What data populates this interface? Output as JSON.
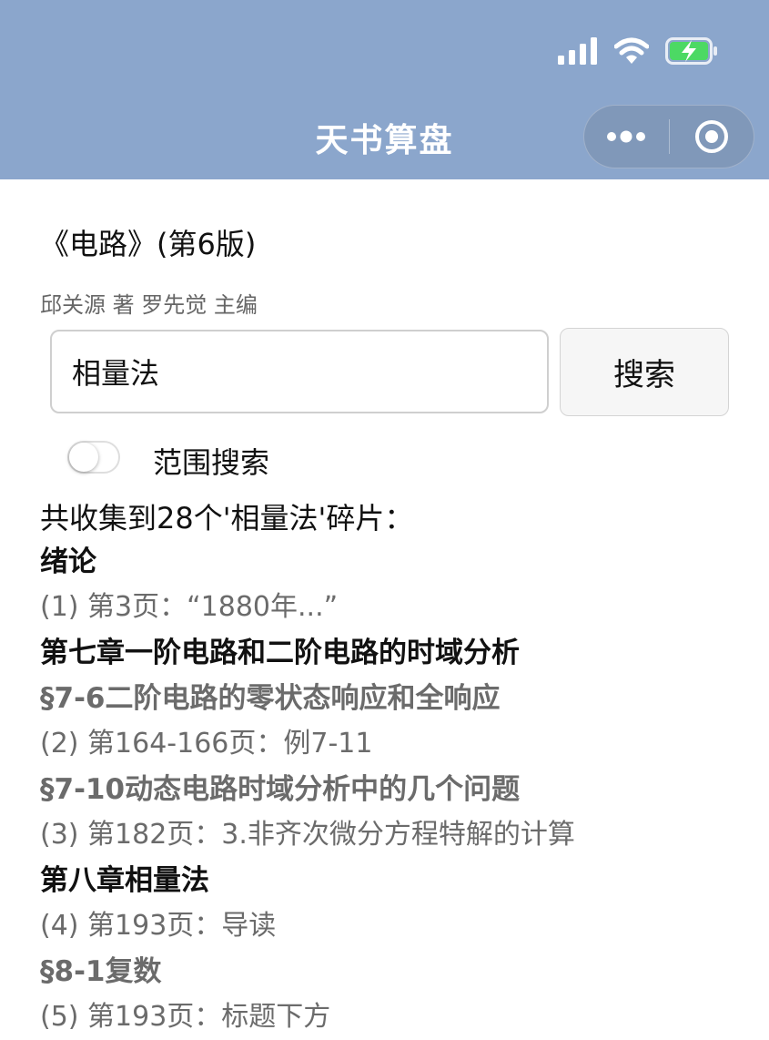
{
  "nav": {
    "title": "天书算盘"
  },
  "book": {
    "title": "《电路》(第6版)",
    "authors": "邱关源 著 罗先觉 主编"
  },
  "search": {
    "value": "相量法",
    "button_label": "搜索"
  },
  "range_toggle": {
    "label": "范围搜索",
    "on": false
  },
  "summary": "共收集到28个'相量法'碎片：",
  "results": [
    {
      "type": "chapter",
      "text": "绪论"
    },
    {
      "type": "entry",
      "text": "(1) 第3页：“1880年...”"
    },
    {
      "type": "chapter",
      "text": "第七章一阶电路和二阶电路的时域分析"
    },
    {
      "type": "section",
      "text": "§7-6二阶电路的零状态响应和全响应"
    },
    {
      "type": "entry",
      "text": "(2) 第164-166页：例7-11"
    },
    {
      "type": "section",
      "text": "§7-10动态电路时域分析中的几个问题"
    },
    {
      "type": "entry",
      "text": "(3) 第182页：3.非齐次微分方程特解的计算"
    },
    {
      "type": "chapter",
      "text": "第八章相量法"
    },
    {
      "type": "entry",
      "text": "(4) 第193页：导读"
    },
    {
      "type": "section",
      "text": "§8-1复数"
    },
    {
      "type": "entry",
      "text": "(5) 第193页：标题下方"
    }
  ],
  "icons": {
    "signal": "signal-icon",
    "wifi": "wifi-icon",
    "battery": "battery-charging-icon",
    "more": "more-dots-icon",
    "close": "close-miniprogram-icon"
  },
  "colors": {
    "header_bg": "#8ba6cc",
    "battery_green": "#4cd964",
    "muted_text": "#6b6b6b"
  }
}
